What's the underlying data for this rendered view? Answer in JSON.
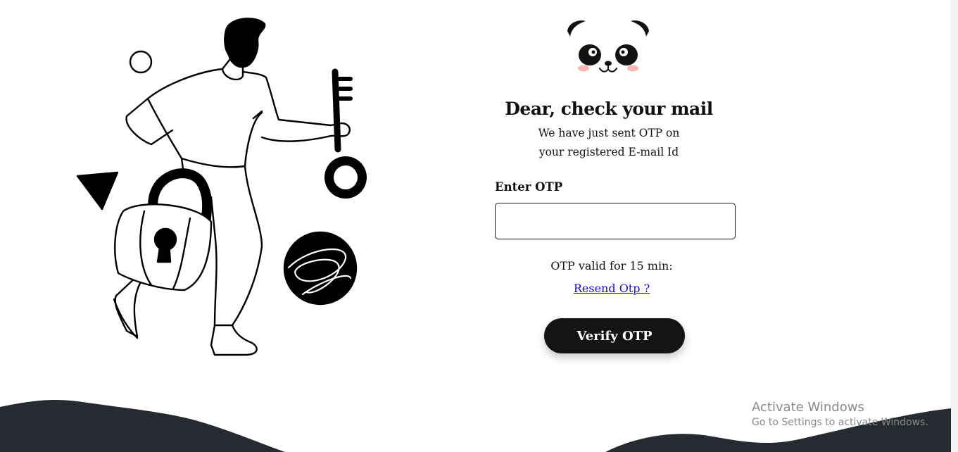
{
  "heading": {
    "title": "Dear, check your mail",
    "subtitle": "We have just sent OTP on your registered E-mail Id"
  },
  "form": {
    "otp_label": "Enter OTP",
    "otp_value": "",
    "validity_text": "OTP valid for 15 min:",
    "resend_link": "Resend Otp ?",
    "verify_button": "Verify OTP"
  },
  "watermark": {
    "title": "Activate Windows",
    "subtitle": "Go to Settings to activate Windows."
  },
  "colors": {
    "button_bg": "#141416",
    "wave": "#262b31",
    "link": "#1a0dcc"
  }
}
